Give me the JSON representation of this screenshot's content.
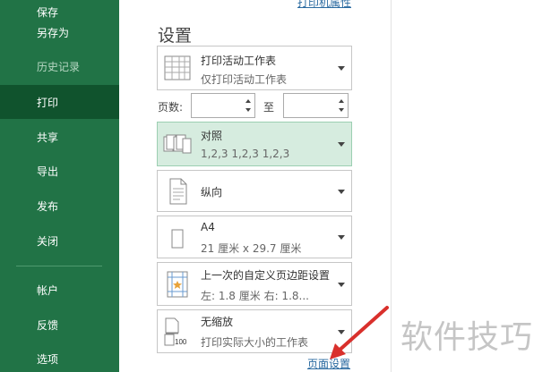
{
  "sidebar": {
    "items": [
      {
        "label": "保存",
        "state": "normal"
      },
      {
        "label": "另存为",
        "state": "normal"
      },
      {
        "label": "历史记录",
        "state": "dim"
      },
      {
        "label": "打印",
        "state": "active"
      },
      {
        "label": "共享",
        "state": "normal"
      },
      {
        "label": "导出",
        "state": "normal"
      },
      {
        "label": "发布",
        "state": "normal"
      },
      {
        "label": "关闭",
        "state": "normal"
      },
      {
        "label": "帐户",
        "state": "normal"
      },
      {
        "label": "反馈",
        "state": "normal"
      },
      {
        "label": "选项",
        "state": "normal"
      }
    ]
  },
  "print": {
    "printer_properties_link": "打印机属性",
    "settings_title": "设置",
    "scope": {
      "title": "打印活动工作表",
      "subtitle": "仅打印活动工作表"
    },
    "pages": {
      "label": "页数:",
      "from_value": "",
      "to_label": "至",
      "to_value": ""
    },
    "collate": {
      "title": "对照",
      "subtitle": "1,2,3    1,2,3    1,2,3"
    },
    "orientation": {
      "title": "纵向"
    },
    "paper": {
      "title": "A4",
      "subtitle": "21 厘米 x 29.7 厘米"
    },
    "margins": {
      "title": "上一次的自定义页边距设置",
      "subtitle": "左: 1.8 厘米    右: 1.8..."
    },
    "scaling": {
      "title": "无缩放",
      "subtitle": "打印实际大小的工作表"
    },
    "page_setup_link": "页面设置"
  },
  "overlay": {
    "watermark": "软件技巧",
    "arrow_color": "#d9302c"
  },
  "colors": {
    "sidebar_bg": "#217346",
    "sidebar_active": "#10532d",
    "selected_card": "#d6ecdf",
    "link": "#2a6aa0"
  }
}
